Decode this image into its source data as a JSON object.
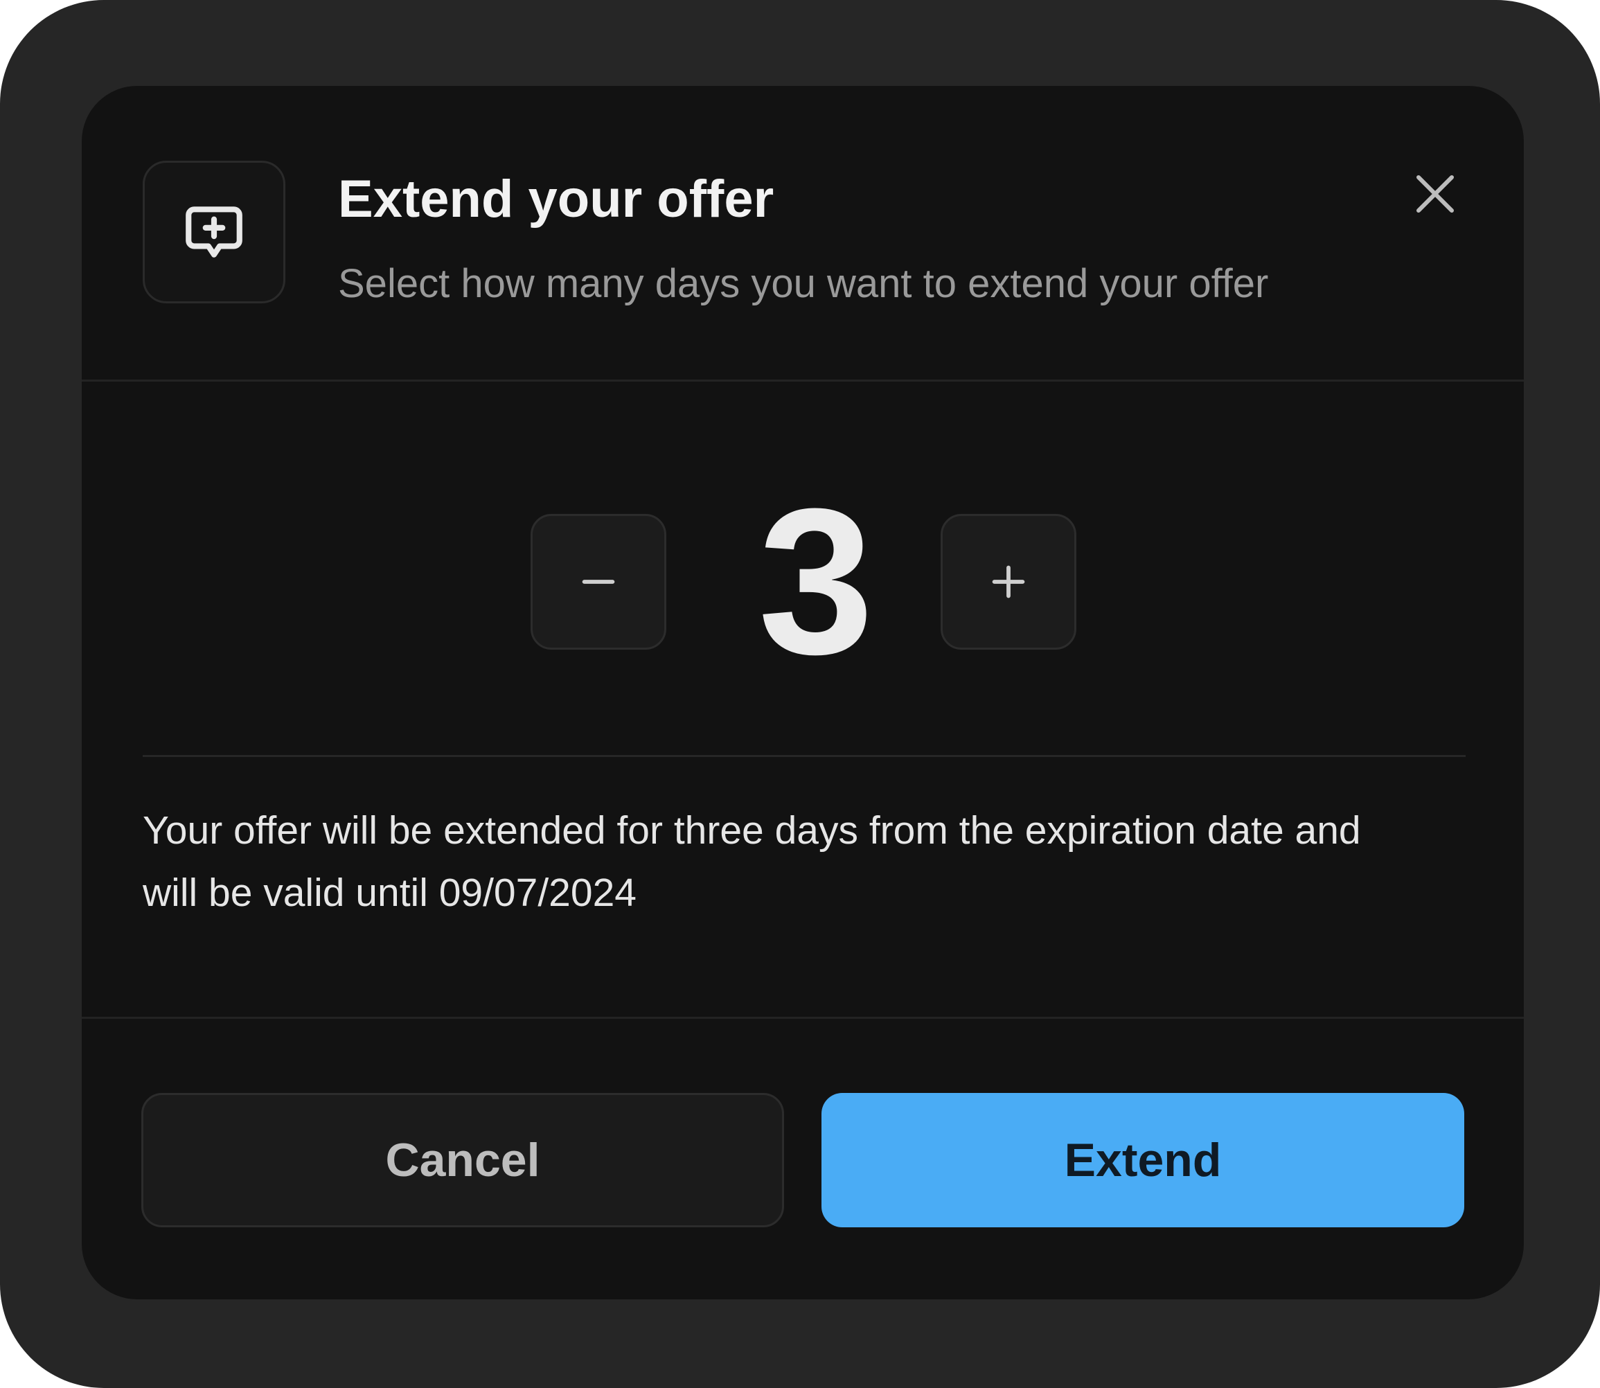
{
  "dialog": {
    "title": "Extend your offer",
    "subtitle": "Select how many days you want to extend your offer",
    "header_icon": "message-plus-icon",
    "close_icon": "close-icon"
  },
  "stepper": {
    "value": "3",
    "decrement_icon": "minus-icon",
    "increment_icon": "plus-icon"
  },
  "message": {
    "line1": "Your offer will be extended for three days from the expiration date and",
    "line2": "will be valid until 09/07/2024"
  },
  "actions": {
    "cancel_label": "Cancel",
    "extend_label": "Extend"
  },
  "colors": {
    "frame": "#262626",
    "dialog_bg": "#121212",
    "accent": "#4aacf5"
  }
}
